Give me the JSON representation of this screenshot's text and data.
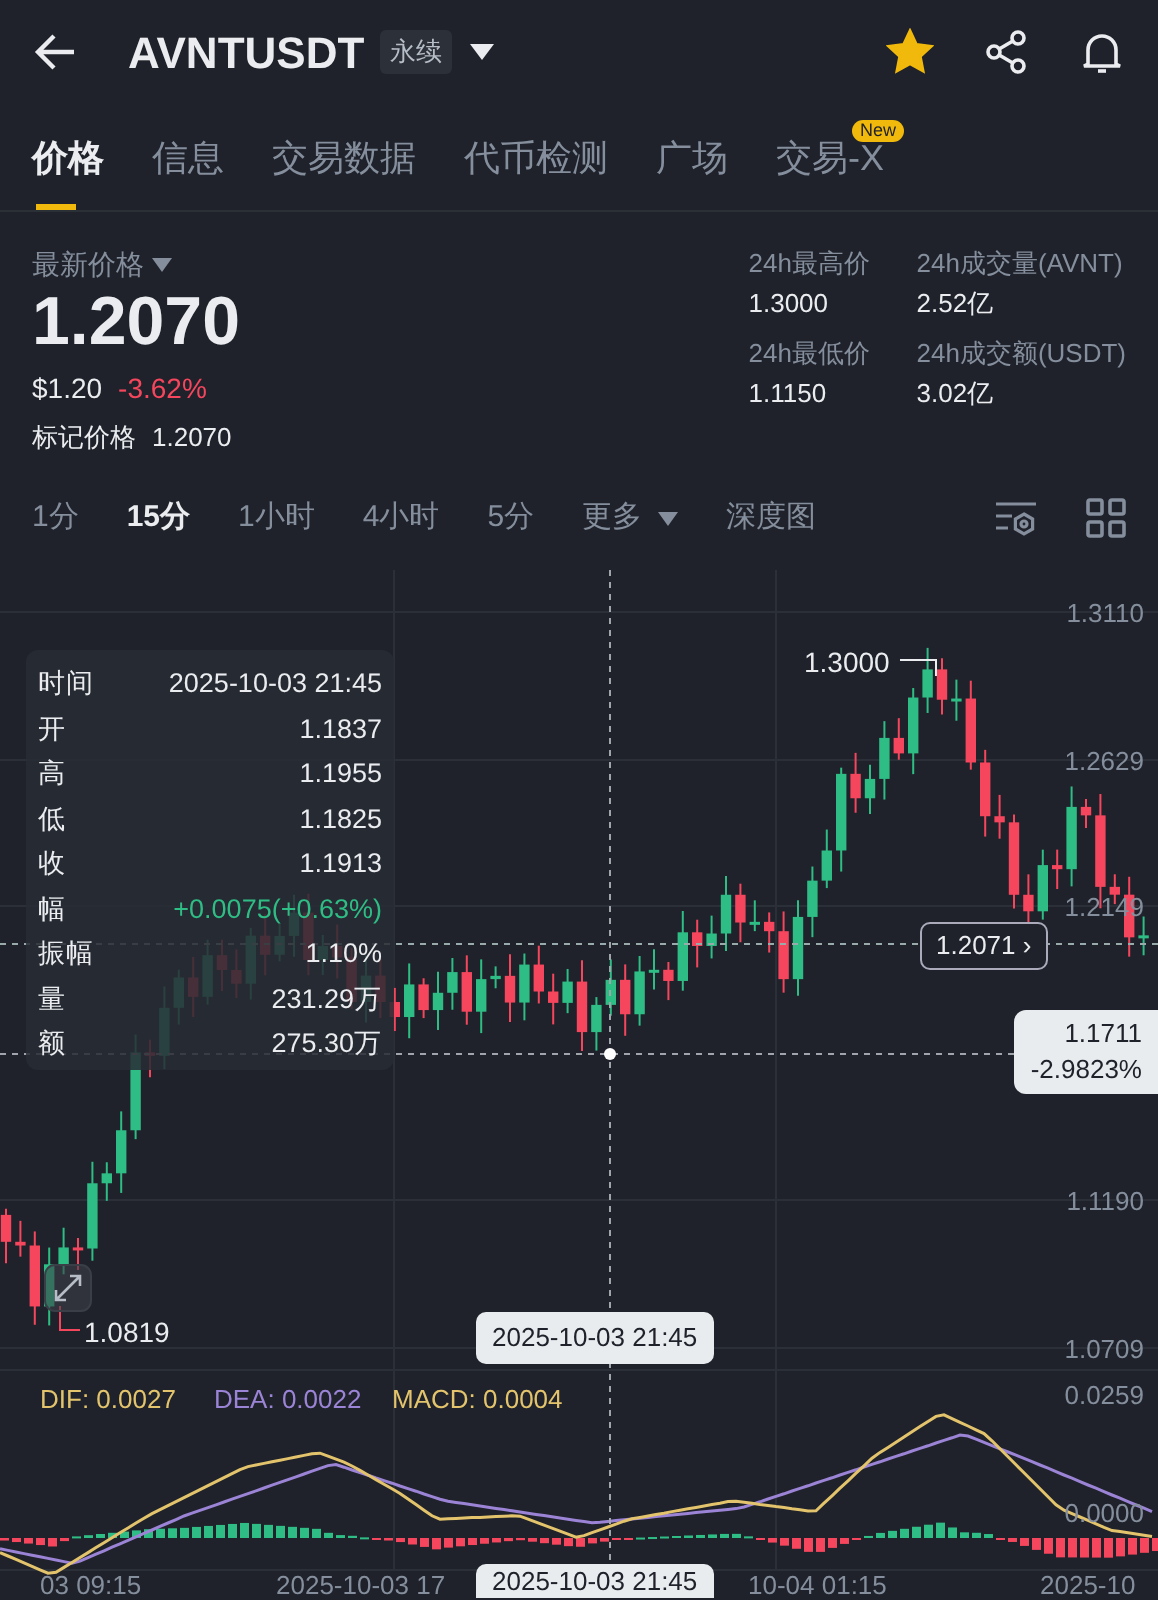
{
  "header": {
    "title": "AVNTUSDT",
    "tag": "永续",
    "favorite": true
  },
  "tabs": [
    {
      "label": "价格",
      "selected": true
    },
    {
      "label": "信息",
      "selected": false
    },
    {
      "label": "交易数据",
      "selected": false
    },
    {
      "label": "代币检测",
      "selected": false
    },
    {
      "label": "广场",
      "selected": false
    },
    {
      "label": "交易-X",
      "selected": false,
      "badge": "New"
    }
  ],
  "ticker": {
    "last_label": "最新价格",
    "last_price": "1.2070",
    "usd_price": "$1.20",
    "change": {
      "text": "-3.62%",
      "color": "#f6465d"
    },
    "mark_label": "标记价格",
    "mark_price": "1.2070",
    "stats": [
      {
        "label": "24h最高价",
        "value": "1.3000"
      },
      {
        "label": "24h成交量(AVNT)",
        "value": "2.52亿"
      },
      {
        "label": "24h最低价",
        "value": "1.1150"
      },
      {
        "label": "24h成交额(USDT)",
        "value": "3.02亿"
      }
    ]
  },
  "intervals": [
    {
      "label": "1分",
      "selected": false
    },
    {
      "label": "15分",
      "selected": true
    },
    {
      "label": "1小时",
      "selected": false
    },
    {
      "label": "4小时",
      "selected": false
    },
    {
      "label": "5分",
      "selected": false
    },
    {
      "label": "更多",
      "selected": false,
      "kind": "dropdown"
    },
    {
      "label": "深度图",
      "selected": false
    }
  ],
  "chart": {
    "y_labels": [
      "1.3110",
      "1.2629",
      "1.2149",
      "1.1190",
      "1.0709"
    ],
    "high_marker": "1.3000",
    "low_marker": "1.0819",
    "last_price_tag": "1.2071 ›",
    "crosshair_price": "1.1711",
    "crosshair_change": "-2.9823%",
    "crosshair_time": "2025-10-03 21:45",
    "tooltip": [
      {
        "label": "时间",
        "value": "2025-10-03 21:45"
      },
      {
        "label": "开",
        "value": "1.1837"
      },
      {
        "label": "高",
        "value": "1.1955"
      },
      {
        "label": "低",
        "value": "1.1825"
      },
      {
        "label": "收",
        "value": "1.1913"
      },
      {
        "label": "幅",
        "value": "+0.0075(+0.63%)",
        "color": "#2ebd85"
      },
      {
        "label": "振幅",
        "value": "1.10%"
      },
      {
        "label": "量",
        "value": "231.29万"
      },
      {
        "label": "额",
        "value": "275.30万"
      }
    ]
  },
  "macd": {
    "legend": [
      {
        "label": "DIF: 0.0027",
        "color": "#e3c46c"
      },
      {
        "label": "DEA: 0.0022",
        "color": "#9b83d6"
      },
      {
        "label": "MACD: 0.0004",
        "color": "#e3c46c"
      }
    ],
    "y_labels": [
      "0.0259",
      "0.0000"
    ]
  },
  "x_axis": {
    "labels": [
      "03 09:15",
      "2025-10-03 17",
      "10-04 01:15",
      "2025-10"
    ],
    "crosshair_time": "2025-10-03 21:45"
  }
}
